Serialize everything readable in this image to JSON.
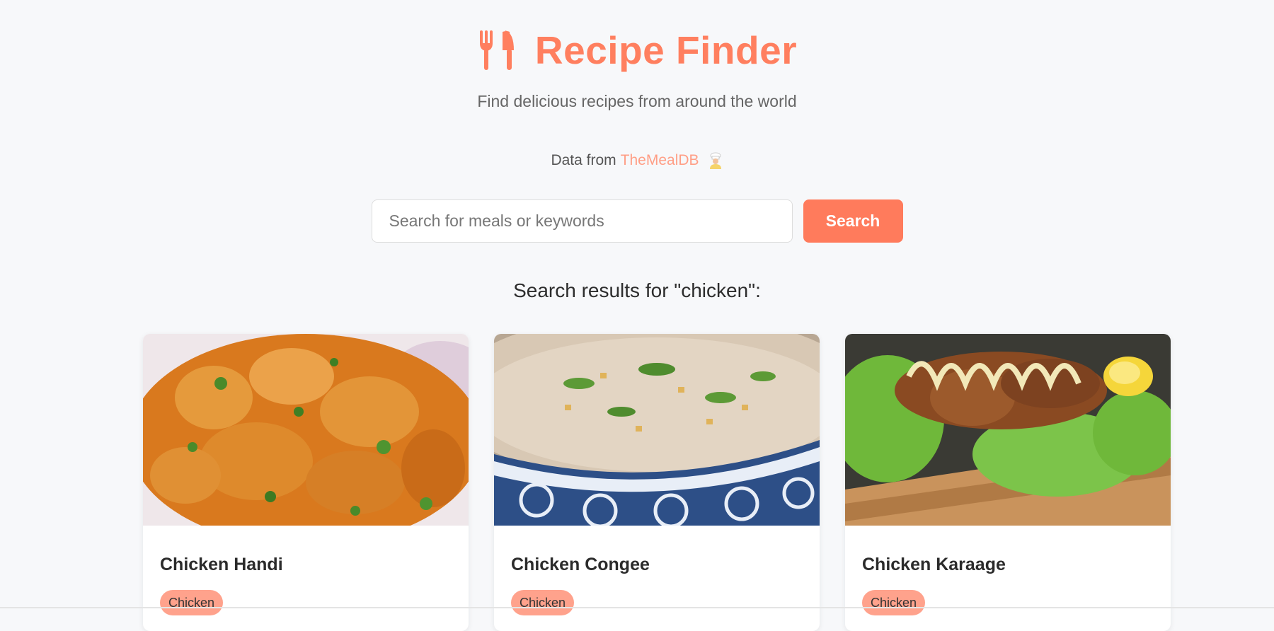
{
  "app": {
    "title": "Recipe Finder",
    "subtitle": "Find delicious recipes from around the world",
    "brand_color": "#ff7f5f",
    "logo_icon": "fork-knife-icon"
  },
  "credits": {
    "prefix": "Data from",
    "source_label": "TheMealDB",
    "icon": "chef-icon"
  },
  "search": {
    "placeholder": "Search for meals or keywords",
    "value": "",
    "button_label": "Search"
  },
  "results": {
    "heading": "Search results for \"chicken\":",
    "items": [
      {
        "title": "Chicken Handi",
        "category": "Chicken",
        "image": "chicken-handi-photo"
      },
      {
        "title": "Chicken Congee",
        "category": "Chicken",
        "image": "chicken-congee-photo"
      },
      {
        "title": "Chicken Karaage",
        "category": "Chicken",
        "image": "chicken-karaage-photo"
      }
    ]
  }
}
